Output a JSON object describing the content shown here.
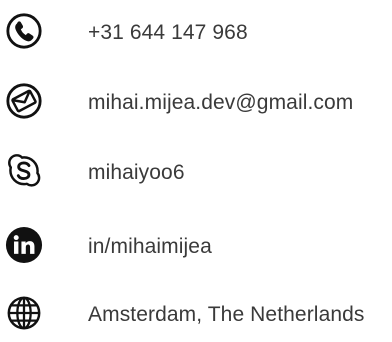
{
  "contacts": {
    "phone": {
      "icon": "phone-icon",
      "text": "+31 644 147 968"
    },
    "email": {
      "icon": "email-icon",
      "text": "mihai.mijea.dev@gmail.com"
    },
    "skype": {
      "icon": "skype-icon",
      "text": "mihaiyoo6"
    },
    "linkedin": {
      "icon": "linkedin-icon",
      "text": "in/mihaimijea"
    },
    "location": {
      "icon": "globe-icon",
      "text": "Amsterdam, The Netherlands"
    }
  },
  "colors": {
    "icon": "#111111",
    "text": "#3a3a3a",
    "background": "#ffffff"
  }
}
